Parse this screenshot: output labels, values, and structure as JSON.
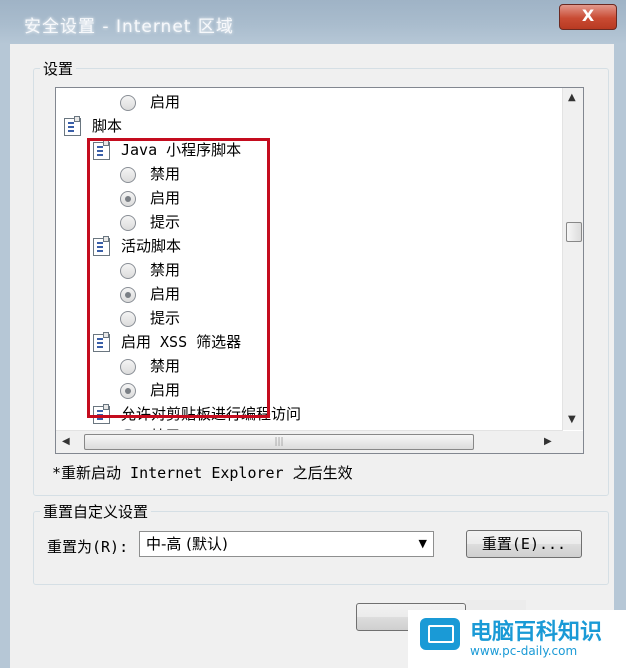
{
  "window": {
    "title": "安全设置 - Internet 区域",
    "close_label": "X"
  },
  "settings_group": {
    "label": "设置",
    "items": [
      {
        "text": "启用",
        "kind": "radio",
        "selected": false
      },
      {
        "text": "脚本",
        "kind": "category"
      },
      {
        "text": "Java 小程序脚本",
        "kind": "category"
      },
      {
        "text": "禁用",
        "kind": "radio",
        "selected": false
      },
      {
        "text": "启用",
        "kind": "radio",
        "selected": true
      },
      {
        "text": "提示",
        "kind": "radio",
        "selected": false
      },
      {
        "text": "活动脚本",
        "kind": "category"
      },
      {
        "text": "禁用",
        "kind": "radio",
        "selected": false
      },
      {
        "text": "启用",
        "kind": "radio",
        "selected": true
      },
      {
        "text": "提示",
        "kind": "radio",
        "selected": false
      },
      {
        "text": "启用 XSS 筛选器",
        "kind": "category"
      },
      {
        "text": "禁用",
        "kind": "radio",
        "selected": false
      },
      {
        "text": "启用",
        "kind": "radio",
        "selected": true
      },
      {
        "text": "允许对剪贴板进行编程访问",
        "kind": "category"
      },
      {
        "text": "禁用",
        "kind": "radio",
        "selected": false
      }
    ],
    "note": "*重新启动 Internet Explorer 之后生效"
  },
  "reset_group": {
    "label": "重置自定义设置",
    "reset_to_label": "重置为(R):",
    "level_value": "中-高 (默认)",
    "reset_button": "重置(E)..."
  },
  "watermark": {
    "title": "电脑百科知识",
    "url": "www.pc-daily.com"
  },
  "colors": {
    "highlight_box": "#c40c1e",
    "close_button": "#c94b33",
    "watermark": "#1a9ad6"
  }
}
